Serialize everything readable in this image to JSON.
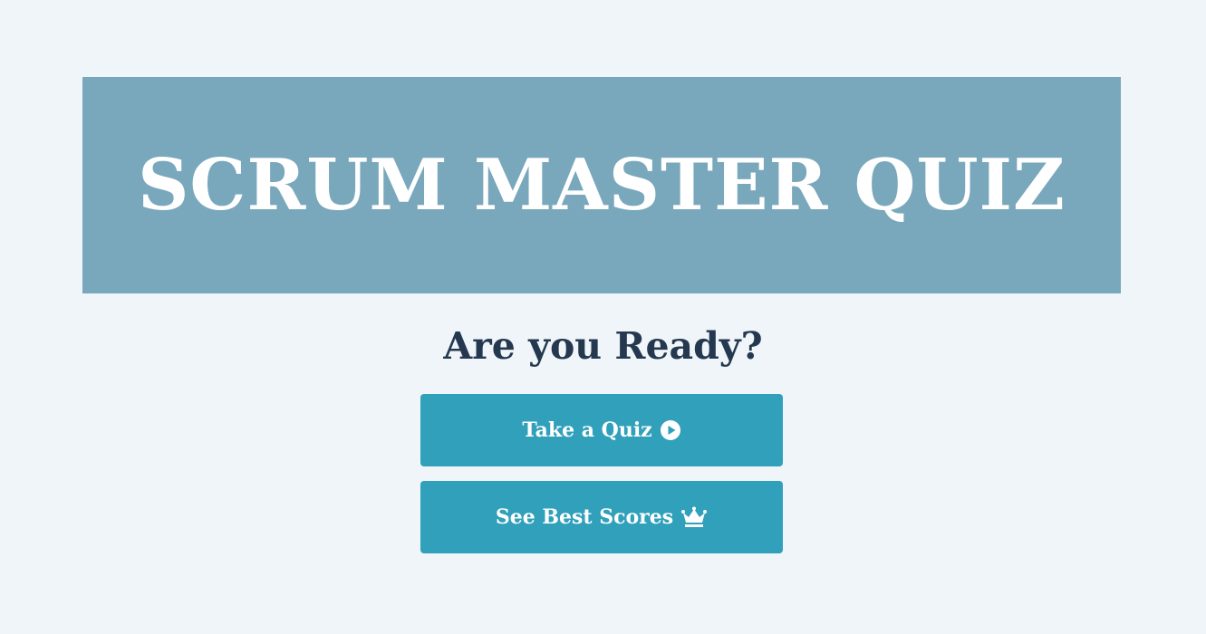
{
  "header": {
    "title": "SCRUM MASTER QUIZ"
  },
  "main": {
    "subtitle": "Are you Ready?",
    "take_quiz_label": "Take a Quiz",
    "take_quiz_icon": "play-circle-icon",
    "best_scores_label": "See Best Scores",
    "best_scores_icon": "crown-icon"
  },
  "colors": {
    "background": "#eff5f9",
    "banner": "#79a8bc",
    "title_text": "#ffffff",
    "subtitle_text": "#24384f",
    "button": "#30a0bb",
    "button_text": "#ffffff"
  }
}
